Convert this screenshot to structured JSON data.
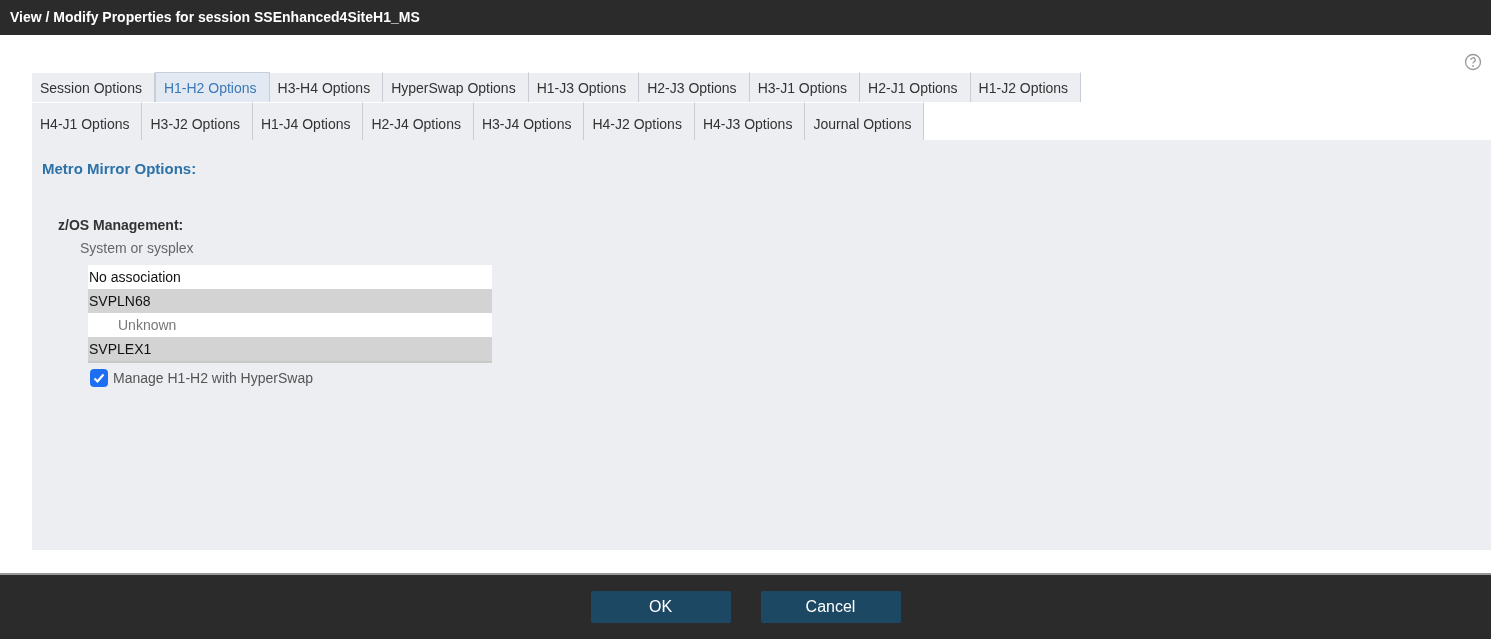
{
  "window": {
    "title": "View / Modify Properties for session SSEnhanced4SiteH1_MS"
  },
  "tab_rows": [
    [
      {
        "label": "Session Options",
        "selected": false
      },
      {
        "label": "H1-H2 Options",
        "selected": true
      },
      {
        "label": "H3-H4 Options",
        "selected": false
      },
      {
        "label": "HyperSwap Options",
        "selected": false
      },
      {
        "label": "H1-J3 Options",
        "selected": false
      },
      {
        "label": "H2-J3 Options",
        "selected": false
      },
      {
        "label": "H3-J1 Options",
        "selected": false
      },
      {
        "label": "H2-J1 Options",
        "selected": false
      },
      {
        "label": "H1-J2 Options",
        "selected": false
      }
    ],
    [
      {
        "label": "H4-J1 Options",
        "selected": false
      },
      {
        "label": "H3-J2 Options",
        "selected": false
      },
      {
        "label": "H1-J4 Options",
        "selected": false
      },
      {
        "label": "H2-J4 Options",
        "selected": false
      },
      {
        "label": "H3-J4 Options",
        "selected": false
      },
      {
        "label": "H4-J2 Options",
        "selected": false
      },
      {
        "label": "H4-J3 Options",
        "selected": false
      },
      {
        "label": "Journal Options",
        "selected": false
      }
    ]
  ],
  "panel": {
    "heading": "Metro Mirror Options:",
    "section": "z/OS Management:",
    "field_label": "System or sysplex",
    "list": [
      {
        "label": "No association",
        "selected": false
      },
      {
        "label": "SVPLN68",
        "selected": true,
        "children": [
          {
            "label": "Unknown",
            "selected": false
          }
        ]
      },
      {
        "label": "SVPLEX1",
        "selected": true
      }
    ],
    "checkbox": {
      "label": "Manage H1-H2 with HyperSwap",
      "checked": true
    }
  },
  "buttons": [
    "OK",
    "Cancel"
  ]
}
